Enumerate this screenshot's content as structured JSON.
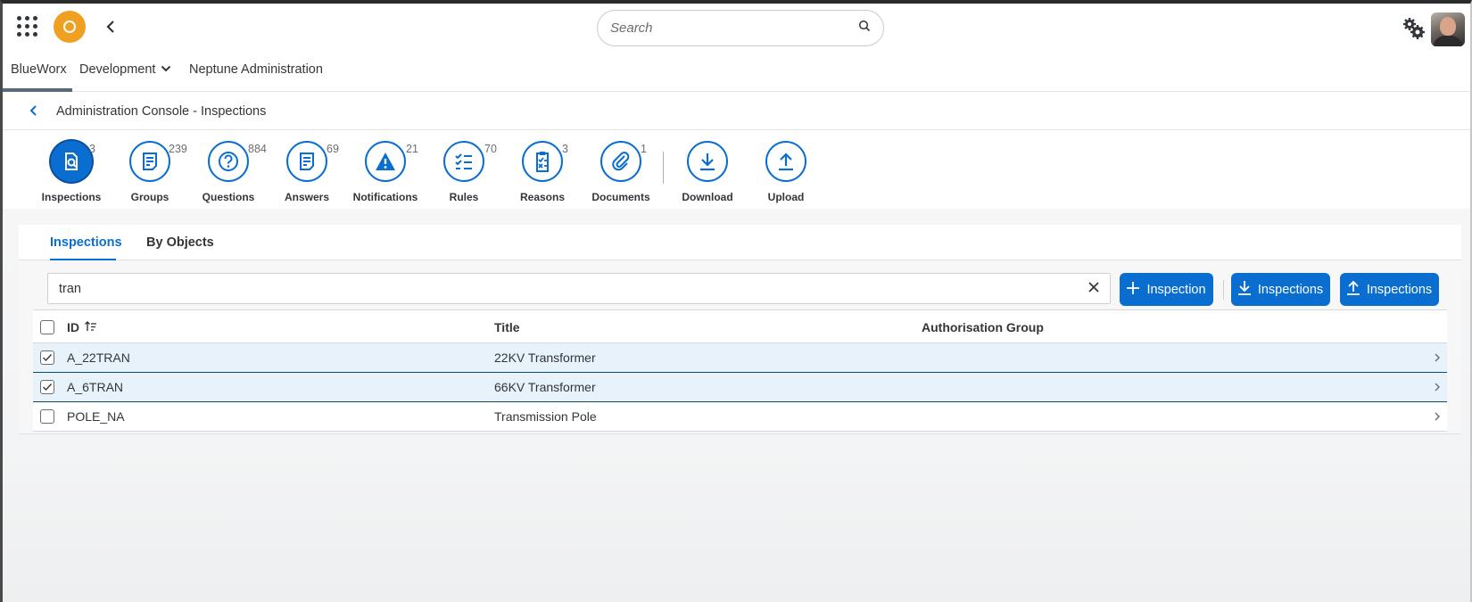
{
  "shell": {
    "search_placeholder": "Search",
    "icons": [
      "grid-menu-icon",
      "company-logo",
      "back-arrow-icon",
      "search-icon",
      "settings-gears-icon",
      "user-avatar"
    ],
    "logo_color": "#f0a020"
  },
  "appnav": {
    "items": [
      {
        "label": "BlueWorx",
        "active": true
      },
      {
        "label": "Development",
        "dropdown": true
      },
      {
        "label": "Neptune Administration"
      }
    ]
  },
  "page": {
    "title": "Administration Console - Inspections"
  },
  "icon_tabs": [
    {
      "label": "Inspections",
      "count": "3",
      "icon": "inspection-search-icon",
      "active": true
    },
    {
      "label": "Groups",
      "count": "239",
      "icon": "document-lines-icon"
    },
    {
      "label": "Questions",
      "count": "884",
      "icon": "question-mark-icon"
    },
    {
      "label": "Answers",
      "count": "69",
      "icon": "document-lines-icon"
    },
    {
      "label": "Notifications",
      "count": "21",
      "icon": "alert-triangle-icon"
    },
    {
      "label": "Rules",
      "count": "70",
      "icon": "checklist-icon"
    },
    {
      "label": "Reasons",
      "count": "3",
      "icon": "checklist-clipboard-icon"
    },
    {
      "label": "Documents",
      "count": "1",
      "icon": "paperclip-icon"
    },
    {
      "label": "Download",
      "count": "",
      "icon": "download-icon"
    },
    {
      "label": "Upload",
      "count": "",
      "icon": "upload-icon"
    }
  ],
  "sub_tabs": [
    {
      "label": "Inspections",
      "active": true
    },
    {
      "label": "By Objects"
    }
  ],
  "filter": {
    "value": "tran"
  },
  "actions": {
    "add_label": "Inspection",
    "download_label": "Inspections",
    "upload_label": "Inspections"
  },
  "table": {
    "columns": [
      "ID",
      "Title",
      "Authorisation Group"
    ],
    "rows": [
      {
        "id": "A_22TRAN",
        "title": "22KV Transformer",
        "auth_group": "",
        "selected": true
      },
      {
        "id": "A_6TRAN",
        "title": "66KV Transformer",
        "auth_group": "",
        "selected": true
      },
      {
        "id": "POLE_NA",
        "title": "Transmission Pole",
        "auth_group": "",
        "selected": false
      }
    ]
  },
  "colors": {
    "accent": "#0a6ed1",
    "selected_row": "#e7f2fb"
  }
}
